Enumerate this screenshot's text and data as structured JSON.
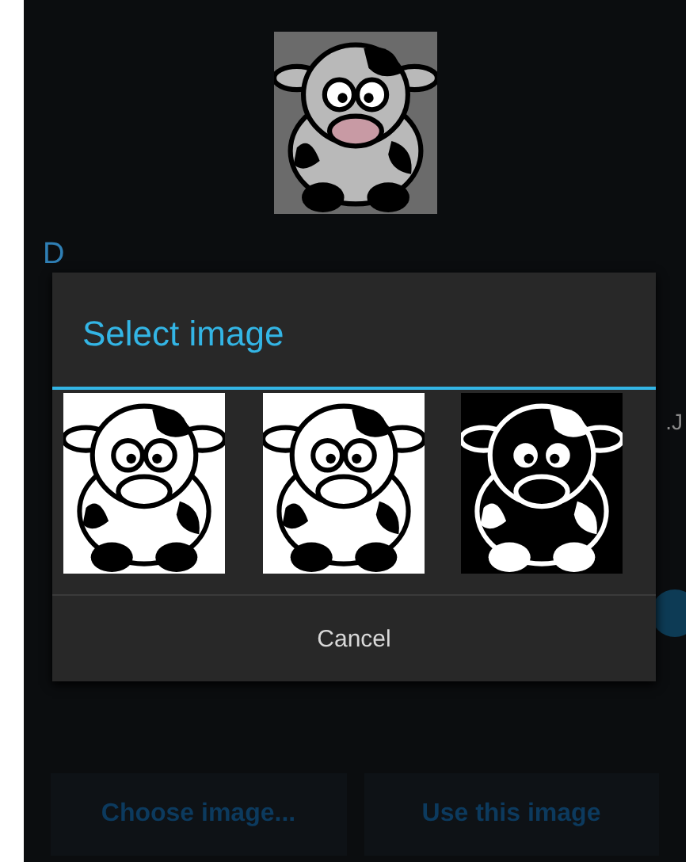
{
  "screen": {
    "section_title": "D",
    "side_text": ".J",
    "buttons": [
      {
        "label": "Choose image..."
      },
      {
        "label": "Use this image"
      }
    ]
  },
  "dialog": {
    "title": "Select image",
    "cancel": "Cancel"
  }
}
